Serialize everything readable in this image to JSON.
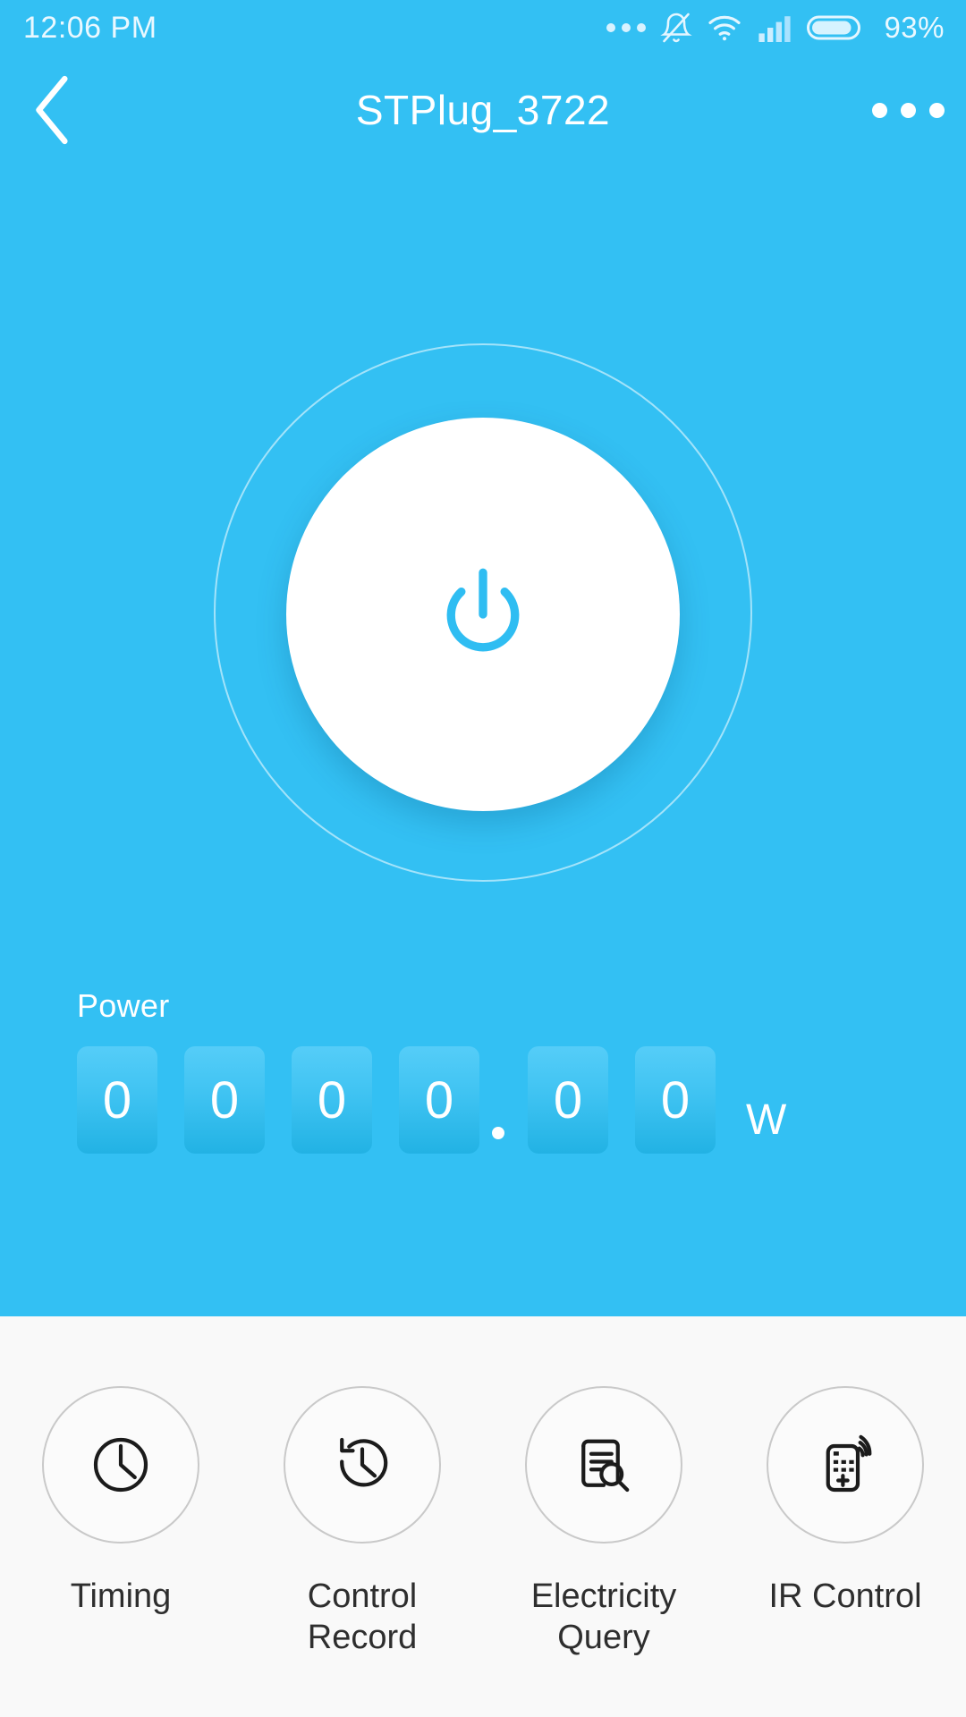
{
  "status_bar": {
    "time": "12:06 PM",
    "battery_percent": "93%",
    "icons": [
      "more-dots-icon",
      "bell-muted-icon",
      "wifi-icon",
      "cellular-signal-icon",
      "battery-icon"
    ]
  },
  "header": {
    "title": "STPlug_3722",
    "back_icon": "chevron-left-icon",
    "menu_icon": "more-horizontal-icon"
  },
  "main": {
    "power_button": {
      "icon": "power-icon",
      "state": "on"
    },
    "power_readout": {
      "label": "Power",
      "digits": [
        "0",
        "0",
        "0",
        "0",
        "0",
        "0"
      ],
      "decimal_after_index": 4,
      "unit": "W",
      "value": "0000.00"
    }
  },
  "actions": [
    {
      "label": "Timing",
      "icon": "clock-icon"
    },
    {
      "label": "Control\nRecord",
      "icon": "history-clock-icon"
    },
    {
      "label": "Electricity\nQuery",
      "icon": "document-search-icon"
    },
    {
      "label": "IR Control",
      "icon": "remote-control-icon"
    }
  ],
  "colors": {
    "brand_blue": "#33c0f3",
    "panel_gray": "#f9f9f9",
    "tile_top": "#55cdf8",
    "tile_bottom": "#22b2e4",
    "label_text": "#2e2e2e"
  }
}
